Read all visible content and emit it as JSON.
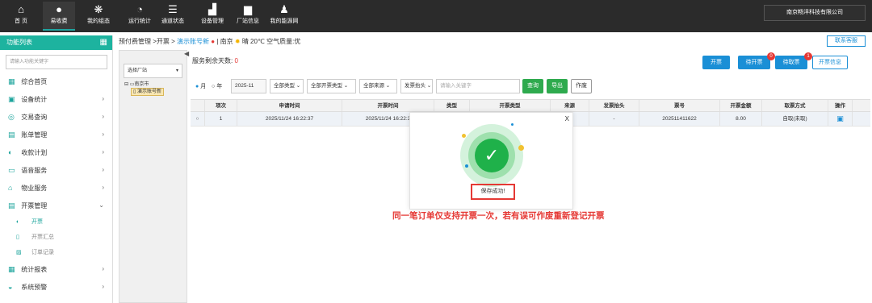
{
  "topnav": {
    "items": [
      {
        "icon": "home-icon",
        "glyph": "⌂",
        "label": "首 页"
      },
      {
        "icon": "money-bag-icon",
        "glyph": "●",
        "label": "易收费"
      },
      {
        "icon": "grid-icon",
        "glyph": "❋",
        "label": "我的组态"
      },
      {
        "icon": "pie-chart-icon",
        "glyph": "◔",
        "label": "运行统计"
      },
      {
        "icon": "sliders-icon",
        "glyph": "☰",
        "label": "通道状态"
      },
      {
        "icon": "org-chart-icon",
        "glyph": "▟",
        "label": "设备管理"
      },
      {
        "icon": "building-icon",
        "glyph": "▆",
        "label": "厂站信息"
      },
      {
        "icon": "user-icon",
        "glyph": "♟",
        "label": "我的能源网"
      }
    ],
    "company": "南京畅洋科技有限公司"
  },
  "sidebar": {
    "title": "功能列表",
    "search_placeholder": "请输入功能关键字",
    "items": [
      {
        "label": "综合首页",
        "icon": "grid-icon",
        "glyph": "▦",
        "chevron": ""
      },
      {
        "label": "设备统计",
        "icon": "chart-box-icon",
        "glyph": "▣",
        "chevron": "›"
      },
      {
        "label": "交易查询",
        "icon": "coins-icon",
        "glyph": "◎",
        "chevron": "›"
      },
      {
        "label": "账单管理",
        "icon": "bill-icon",
        "glyph": "▤",
        "chevron": "›"
      },
      {
        "label": "收款计划",
        "icon": "plan-icon",
        "glyph": "◐",
        "chevron": "›"
      },
      {
        "label": "语音服务",
        "icon": "voice-icon",
        "glyph": "▭",
        "chevron": "›"
      },
      {
        "label": "物业服务",
        "icon": "house-icon",
        "glyph": "⌂",
        "chevron": "›"
      },
      {
        "label": "开票管理",
        "icon": "invoice-icon",
        "glyph": "▤",
        "chevron": "⌄"
      }
    ],
    "sub_items": [
      {
        "label": "开票",
        "icon": "ticket-icon",
        "glyph": "◐",
        "active": true
      },
      {
        "label": "开票汇总",
        "icon": "summary-icon",
        "glyph": "▯",
        "active": false
      },
      {
        "label": "订单记录",
        "icon": "order-icon",
        "glyph": "▨",
        "active": false
      }
    ],
    "items_after": [
      {
        "label": "统计报表",
        "icon": "report-icon",
        "glyph": "▦",
        "chevron": "›"
      },
      {
        "label": "系统预警",
        "icon": "alert-icon",
        "glyph": "◒",
        "chevron": "›"
      }
    ]
  },
  "breadcrumb": {
    "path": "预付费管理 >开票 > ",
    "current": "演示账号新",
    "city": "南京",
    "weather": "晴 20℃ 空气质量:优"
  },
  "contact_button": "联系客服",
  "station_panel": {
    "select_label": "选择厂站",
    "tree_root": "南京市",
    "tree_node": "演示账号新"
  },
  "main": {
    "days_label": "服务剩余天数:",
    "days_value": "0",
    "buttons": {
      "invoice": "开票",
      "pending_invoice": "待开票",
      "pending_invoice_badge": "0",
      "pending_pickup": "待取票",
      "pending_pickup_badge": "1",
      "invoice_info": "开票信息"
    },
    "filters": {
      "radio_month": "月",
      "radio_year": "年",
      "month_value": "2025-11",
      "type": "全部类型",
      "invoice_type": "全部开票类型",
      "source": "全部来源",
      "header_type": "发票抬头",
      "keyword_placeholder": "请输入关键字",
      "query": "查询",
      "export": "导出",
      "void": "作废"
    },
    "table": {
      "columns": [
        "",
        "项次",
        "申请时间",
        "开票时间",
        "类型",
        "开票类型",
        "来源",
        "发票抬头",
        "票号",
        "开票金额",
        "取票方式",
        "操作"
      ],
      "rows": [
        [
          "○",
          "1",
          "2025/11/24 16:22:37",
          "2025/11/24 16:22:3",
          "",
          "",
          "端",
          "-",
          "202511411622",
          "8.00",
          "自取(未取)",
          ""
        ]
      ]
    }
  },
  "toast": {
    "close": "X",
    "message": "保存成功!"
  },
  "annotation": "同一笔订单仅支持开票一次，若有误可作废重新登记开票",
  "colors": {
    "accent": "#1db39f",
    "primary": "#1a8fd6",
    "danger": "#e53935",
    "success": "#2eaa4e"
  }
}
